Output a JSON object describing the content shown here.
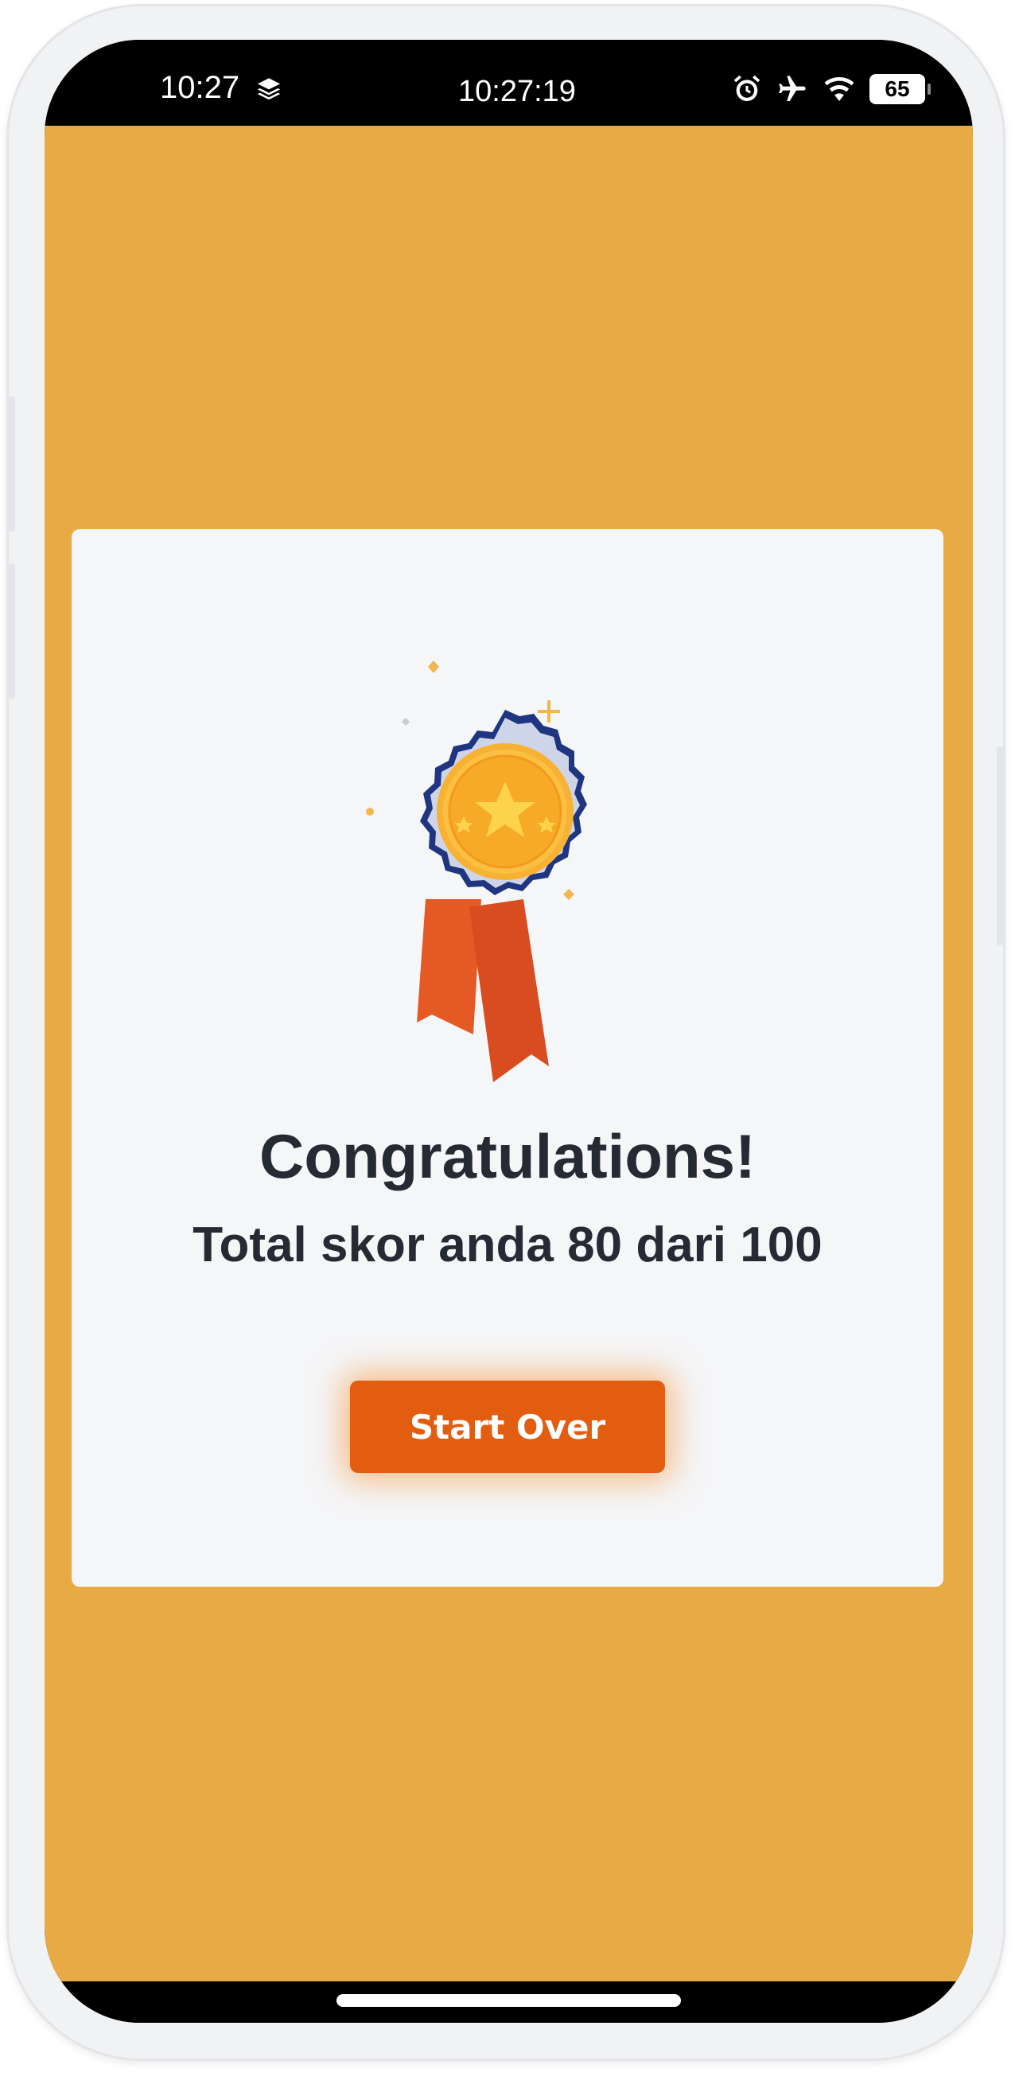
{
  "statusbar": {
    "time_left": "10:27",
    "time_center": "10:27:19",
    "battery": "65",
    "icons": [
      "layers-icon",
      "alarm-icon",
      "airplane-icon",
      "wifi-icon",
      "battery-icon"
    ]
  },
  "colors": {
    "background": "#e8aa45",
    "card": "#f5f6f8",
    "button": "#e35d10",
    "text": "#262a33"
  },
  "result": {
    "title": "Congratulations!",
    "score_text": "Total skor anda 80 dari 100",
    "score": 80,
    "max_score": 100,
    "icon": "award-medal-icon"
  },
  "actions": {
    "start_over_label": "Start Over"
  }
}
